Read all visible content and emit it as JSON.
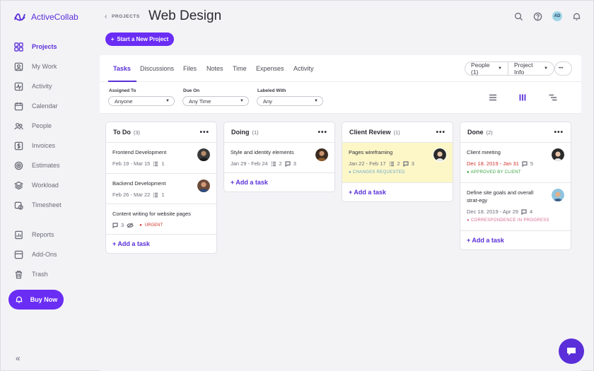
{
  "app": {
    "name": "ActiveCollab"
  },
  "sidebar": {
    "items": [
      {
        "label": "Projects",
        "icon": "grid-icon"
      },
      {
        "label": "My Work",
        "icon": "user-card-icon"
      },
      {
        "label": "Activity",
        "icon": "activity-icon"
      },
      {
        "label": "Calendar",
        "icon": "calendar-icon"
      },
      {
        "label": "People",
        "icon": "people-icon"
      },
      {
        "label": "Invoices",
        "icon": "dollar-icon"
      },
      {
        "label": "Estimates",
        "icon": "target-icon"
      },
      {
        "label": "Workload",
        "icon": "layers-icon"
      },
      {
        "label": "Timesheet",
        "icon": "clock-calendar-icon"
      },
      {
        "label": "Reports",
        "icon": "report-icon"
      },
      {
        "label": "Add-Ons",
        "icon": "addon-icon"
      },
      {
        "label": "Trash",
        "icon": "trash-icon"
      }
    ],
    "buy_now": "Buy Now",
    "collapse": "«"
  },
  "header": {
    "breadcrumb": "PROJECTS",
    "title": "Web Design",
    "new_project": "Start a New Project",
    "avatar_initials": "AD"
  },
  "tabs": [
    "Tasks",
    "Discussions",
    "Files",
    "Notes",
    "Time",
    "Expenses",
    "Activity"
  ],
  "header_buttons": {
    "people": "People (1)",
    "project_info": "Project Info",
    "more": "•••"
  },
  "filters": {
    "assigned_to": {
      "label": "Assigned To",
      "value": "Anyone"
    },
    "due_on": {
      "label": "Due On",
      "value": "Any Time"
    },
    "labeled_with": {
      "label": "Labeled With",
      "value": "Any"
    }
  },
  "columns": [
    {
      "name": "To Do",
      "count": "(3)",
      "tasks": [
        {
          "title": "Frontend Development",
          "meta": "Feb 19 - Mar 15",
          "sub": "1"
        },
        {
          "title": "Backend Development",
          "meta": "Feb 26 - Mar 22",
          "sub": "1"
        },
        {
          "title": "Content writing for website pages",
          "comments": "3",
          "tag": "URGENT"
        }
      ],
      "add_task": "+ Add a task"
    },
    {
      "name": "Doing",
      "count": "(1)",
      "tasks": [
        {
          "title": "Style and identity elements",
          "meta": "Jan 29 - Feb 24",
          "sub": "2",
          "comments": "3"
        }
      ],
      "add_task": "+ Add a task"
    },
    {
      "name": "Client Review",
      "count": "(1)",
      "tasks": [
        {
          "title": "Pages wireframing",
          "meta": "Jan 22 - Feb 17",
          "sub": "2",
          "comments": "3",
          "tag": "CHANGES REQUESTED"
        }
      ],
      "add_task": "+ Add a task"
    },
    {
      "name": "Done",
      "count": "(2)",
      "tasks": [
        {
          "title": "Client meeting",
          "meta": "Dec 18. 2019 - Jan 31",
          "comments": "5",
          "tag": "APPROVED BY CLIENT"
        },
        {
          "title": "Define site goals and overall strat-egy",
          "meta": "Dec 18. 2019 - Apr 29",
          "comments": "4",
          "tag": "CORRESPONDENCE IN PROGRESS"
        }
      ],
      "add_task": "+ Add a task"
    }
  ],
  "colors": {
    "accent": "#5a2fd9",
    "button": "#6a2df4",
    "urgent": "#d0342c",
    "approved": "#3aa33f",
    "highlight": "#fdf7c8"
  }
}
